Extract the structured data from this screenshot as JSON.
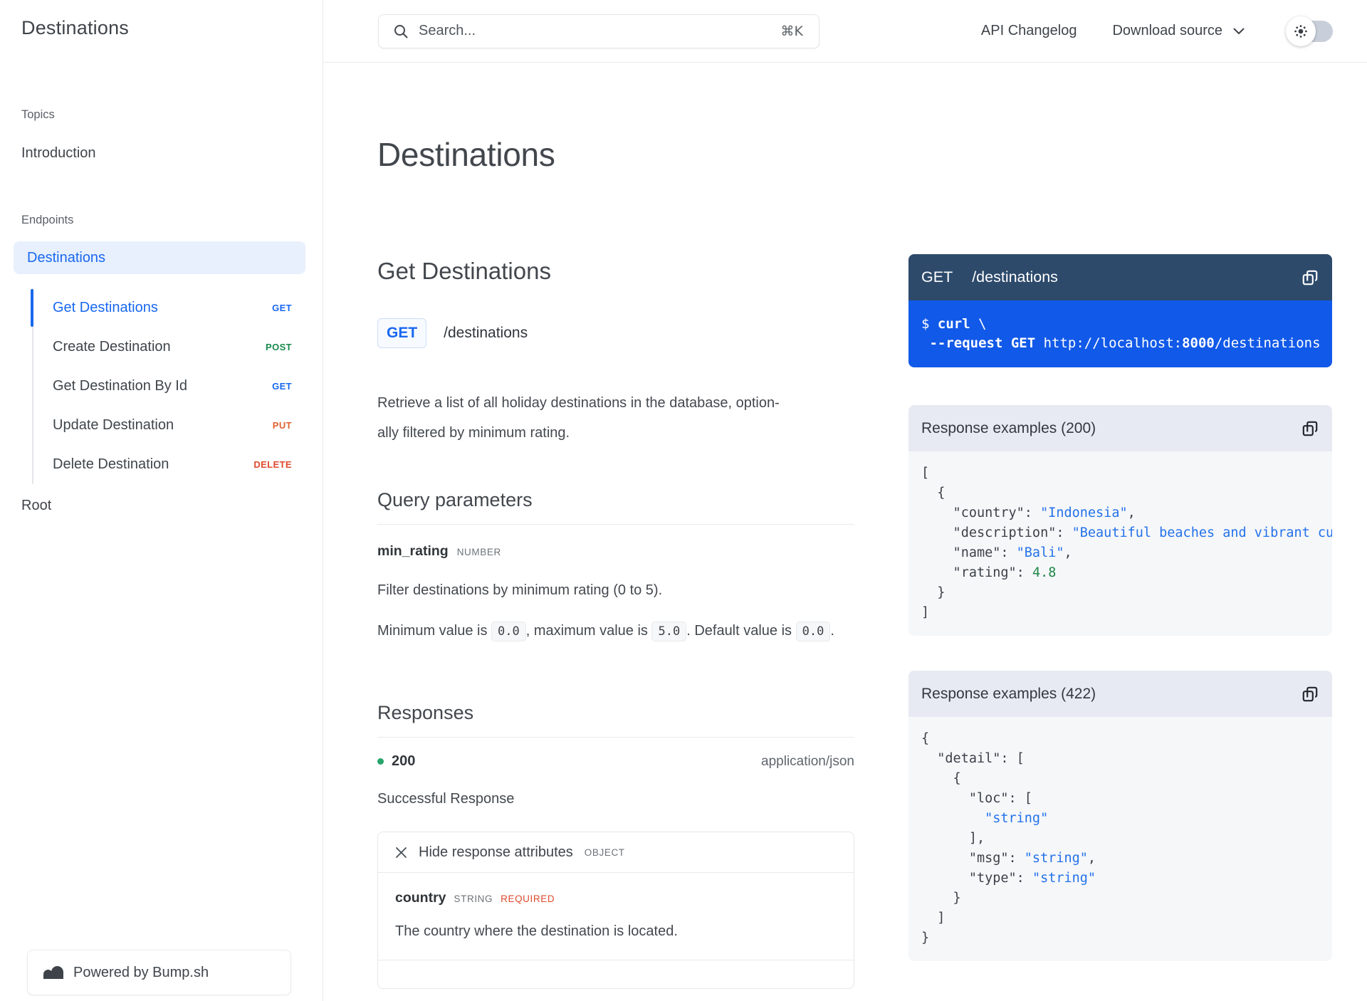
{
  "colors": {
    "accent_blue": "#1968ef",
    "curl_body_blue": "#1159e8",
    "panel_navy": "#2d4a6b",
    "post_green": "#188a4c",
    "put_orange": "#e0612f",
    "delete_red": "#de4a2c",
    "required_red": "#de4a2c",
    "status_dot_green": "#27a56a",
    "json_string_blue": "#2372ea",
    "json_number_green": "#1d8749",
    "active_pill_bg": "#e8f0fd",
    "example_header_bg": "#e7eaf2",
    "example_body_bg": "#f6f7f9"
  },
  "sidebar": {
    "title": "Destinations",
    "topics_label": "Topics",
    "introduction": "Introduction",
    "endpoints_label": "Endpoints",
    "active_group": "Destinations",
    "endpoints": [
      {
        "label": "Get Destinations",
        "method": "GET"
      },
      {
        "label": "Create Destination",
        "method": "POST"
      },
      {
        "label": "Get Destination By Id",
        "method": "GET"
      },
      {
        "label": "Update Destination",
        "method": "PUT"
      },
      {
        "label": "Delete Destination",
        "method": "DELETE"
      }
    ],
    "root": "Root",
    "powered_by": "Powered by Bump.sh"
  },
  "header": {
    "search_placeholder": "Search...",
    "search_shortcut": "⌘K",
    "api_changelog": "API Changelog",
    "download_source": "Download source"
  },
  "doc": {
    "page_title": "Destinations",
    "operation_title": "Get Destinations",
    "method": "GET",
    "path": "/destinations",
    "description_line1": "Retrieve a list of all holiday destinations in the database, option-",
    "description_line2": "ally filtered by minimum rating.",
    "query_parameters_title": "Query parameters",
    "param": {
      "name": "min_rating",
      "type": "NUMBER",
      "description": "Filter destinations by minimum rating (0 to 5).",
      "constraints": [
        [
          "t",
          "Minimum value is "
        ],
        [
          "code",
          "0.0"
        ],
        [
          "t",
          ", maximum value is "
        ],
        [
          "code",
          "5.0"
        ],
        [
          "t",
          ". Default value is "
        ],
        [
          "code",
          "0.0"
        ],
        [
          "t",
          "."
        ]
      ]
    },
    "responses_title": "Responses",
    "response": {
      "status": "200",
      "content_type": "application/json",
      "summary": "Successful Response",
      "attributes_toggle": "Hide response attributes",
      "attributes_kind": "OBJECT",
      "attribute": {
        "name": "country",
        "type": "STRING",
        "required_label": "REQUIRED",
        "description": "The country where the destination is located."
      }
    }
  },
  "panels": {
    "request": {
      "method": "GET",
      "path": "/destinations",
      "code": [
        [
          [
            "p",
            "$ "
          ],
          [
            "b",
            "curl"
          ],
          [
            "p",
            " \\"
          ]
        ],
        [
          [
            "p",
            " "
          ],
          [
            "b",
            "--request GET"
          ],
          [
            "p",
            " http://localhost:"
          ],
          [
            "b",
            "8000"
          ],
          [
            "p",
            "/destinations"
          ]
        ]
      ]
    },
    "resp200": {
      "title": "Response examples (200)",
      "code": [
        [
          [
            "p",
            "["
          ]
        ],
        [
          [
            "p",
            "  {"
          ]
        ],
        [
          [
            "p",
            "    \"country\": "
          ],
          [
            "s",
            "\"Indonesia\""
          ],
          [
            "p",
            ","
          ]
        ],
        [
          [
            "p",
            "    \"description\": "
          ],
          [
            "s",
            "\"Beautiful beaches and vibrant cu"
          ]
        ],
        [
          [
            "p",
            "    \"name\": "
          ],
          [
            "s",
            "\"Bali\""
          ],
          [
            "p",
            ","
          ]
        ],
        [
          [
            "p",
            "    \"rating\": "
          ],
          [
            "n",
            "4.8"
          ]
        ],
        [
          [
            "p",
            "  }"
          ]
        ],
        [
          [
            "p",
            "]"
          ]
        ]
      ]
    },
    "resp422": {
      "title": "Response examples (422)",
      "code": [
        [
          [
            "p",
            "{"
          ]
        ],
        [
          [
            "p",
            "  \"detail\": ["
          ]
        ],
        [
          [
            "p",
            "    {"
          ]
        ],
        [
          [
            "p",
            "      \"loc\": ["
          ]
        ],
        [
          [
            "p",
            "        "
          ],
          [
            "s",
            "\"string\""
          ]
        ],
        [
          [
            "p",
            "      ],"
          ]
        ],
        [
          [
            "p",
            "      \"msg\": "
          ],
          [
            "s",
            "\"string\""
          ],
          [
            "p",
            ","
          ]
        ],
        [
          [
            "p",
            "      \"type\": "
          ],
          [
            "s",
            "\"string\""
          ]
        ],
        [
          [
            "p",
            "    }"
          ]
        ],
        [
          [
            "p",
            "  ]"
          ]
        ],
        [
          [
            "p",
            "}"
          ]
        ]
      ]
    }
  }
}
